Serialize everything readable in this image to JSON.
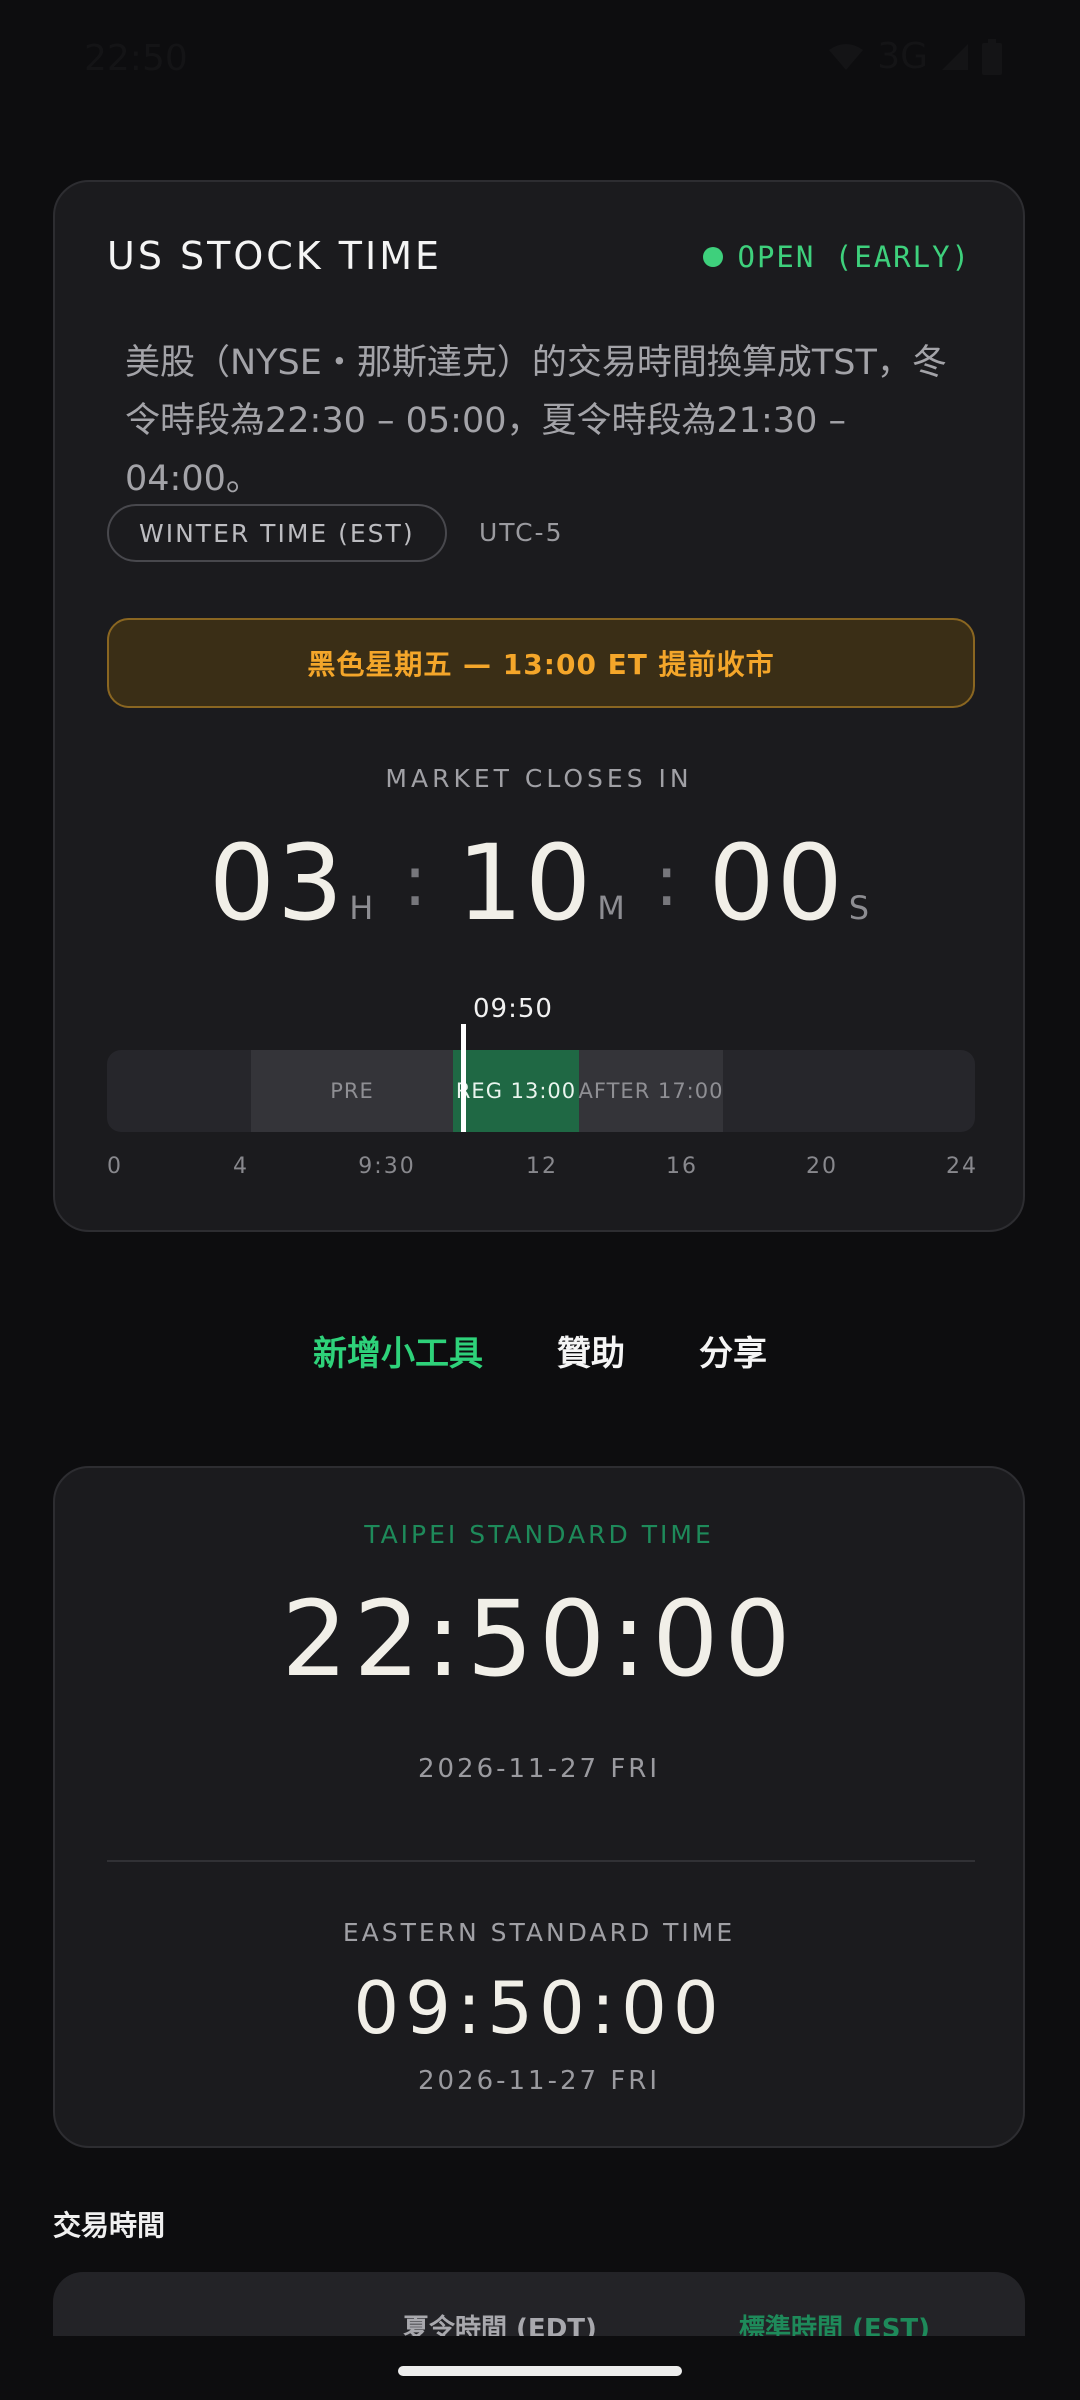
{
  "status_bar": {
    "time": "22:50",
    "network": "3G"
  },
  "card": {
    "title": "US STOCK TIME",
    "status": "OPEN (EARLY)",
    "description": "美股（NYSE・那斯達克）的交易時間換算成TST，冬令時段為22:30 – 05:00，夏令時段為21:30 – 04:00。",
    "season_badge": "WINTER TIME (EST)",
    "utc_offset": "UTC-5",
    "notice": "黑色星期五 — 13:00 ET 提前收市",
    "countdown_label": "MARKET CLOSES IN",
    "countdown": {
      "hours": "03",
      "h_unit": "H",
      "minutes": "10",
      "m_unit": "M",
      "seconds": "00",
      "s_unit": "S",
      "separator": ":"
    },
    "timeline": {
      "current_label": "09:50",
      "current_hour": 9.833,
      "segments": {
        "pre": "PRE",
        "regular": "REG 13:00",
        "after": "AFTER 17:00"
      },
      "ticks": [
        "0",
        "4",
        "9:30",
        "12",
        "16",
        "20",
        "24"
      ],
      "colors": {
        "regular": "#1f6844",
        "extended": "#343439"
      }
    }
  },
  "actions": {
    "add_widget": "新增小工具",
    "sponsor": "贊助",
    "share": "分享"
  },
  "clocks": {
    "taipei": {
      "label": "TAIPEI STANDARD TIME",
      "time": "22:50:00",
      "date": "2026-11-27 FRI"
    },
    "eastern": {
      "label": "EASTERN STANDARD TIME",
      "time": "09:50:00",
      "date": "2026-11-27 FRI"
    }
  },
  "trading_hours": {
    "title": "交易時間",
    "col_summer": "夏令時間 (EDT)",
    "col_standard": "標準時間 (EST)"
  },
  "colors": {
    "accent_green": "#3ed07c",
    "notice_orange": "#f4a62a",
    "background": "#0d0d0f",
    "card": "#1b1b1e"
  }
}
